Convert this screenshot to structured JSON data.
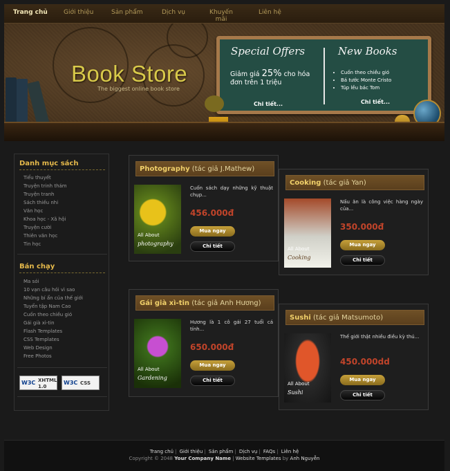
{
  "nav": {
    "items": [
      "Trang chủ",
      "Giới thiệu",
      "Sản phẩm",
      "Dịch vụ",
      "Khuyến mãi",
      "Liên hệ"
    ]
  },
  "header": {
    "logo_title": "Book Store",
    "logo_subtitle": "The biggest online book store",
    "special": {
      "title": "Special Offers",
      "line1": "Giảm giá",
      "percent": "25%",
      "line1_tail": "cho hóa",
      "line2": "đơn trên 1 triệu",
      "button": "Chi tiết..."
    },
    "new_books": {
      "title": "New Books",
      "items": [
        "Cuốn theo chiều gió",
        "Bá tước Monte Cristo",
        "Túp lều bác Tom"
      ],
      "button": "Chi tiết..."
    }
  },
  "sidebar": {
    "categories_title": "Danh mục sách",
    "categories": [
      "Tiểu thuyết",
      "Truyện trinh thám",
      "Truyện tranh",
      "Sách thiếu nhi",
      "Văn học",
      "Khoa học - Xã hội",
      "Truyện cười",
      "Thiên văn học",
      "Tin học"
    ],
    "bestsellers_title": "Bán chạy",
    "bestsellers": [
      "Ma sói",
      "10 vạn câu hỏi vì sao",
      "Những bí ẩn của thế giới",
      "Tuyển tập Nam Cao",
      "Cuốn theo chiều gió",
      "Gái già xì-tin",
      "Flash Templates",
      "CSS Templates",
      "Web Design",
      "Free Photos"
    ],
    "badges": {
      "xhtml": [
        "W3C",
        "XHTML",
        "1.0"
      ],
      "css": [
        "W3C",
        "CSS"
      ]
    }
  },
  "products": [
    {
      "title": "Photography",
      "author": "(tác giả J.Mathew)",
      "cover_caption": "All About",
      "cover_title": "photography",
      "desc": "Cuốn sách dạy những kỹ thuật chụp...",
      "price": "456.000đ",
      "buy": "Mua ngay",
      "detail": "Chi tiết"
    },
    {
      "title": "Cooking",
      "author": "(tác giả Yan)",
      "cover_caption": "All About",
      "cover_title": "Cooking",
      "desc": "Nấu ăn là công việc hàng ngày của...",
      "price": "350.000đ",
      "buy": "Mua ngay",
      "detail": "Chi tiết"
    },
    {
      "title": "Gái già xì-tin",
      "author": "(tác giả Anh Hương)",
      "cover_caption": "All About",
      "cover_title": "Gardening",
      "desc": "Hương là 1 cô gái 27 tuổi cá tính...",
      "price": "650.000đ",
      "buy": "Mua ngay",
      "detail": "Chi tiết"
    },
    {
      "title": "Sushi",
      "author": "(tác giả Matsumoto)",
      "cover_caption": "All About",
      "cover_title": "Sushi",
      "desc": "Thế giới thật nhiều điều kỳ thú...",
      "price": "450.000dd",
      "buy": "Mua ngay",
      "detail": "Chi tiết"
    }
  ],
  "footer": {
    "links": [
      "Trang chủ",
      "Giới thiệu",
      "Sản phẩm",
      "Dịch vụ",
      "FAQs",
      "Liên hệ"
    ],
    "copyright": "Copyright © 2048",
    "company": "Your Company Name",
    "templates": "Website Templates",
    "by": "by",
    "author": "Anh Nguyễn"
  },
  "colors": {
    "accent_gold": "#e5b94b",
    "price_red": "#c1442a",
    "board_green": "#244d44"
  }
}
